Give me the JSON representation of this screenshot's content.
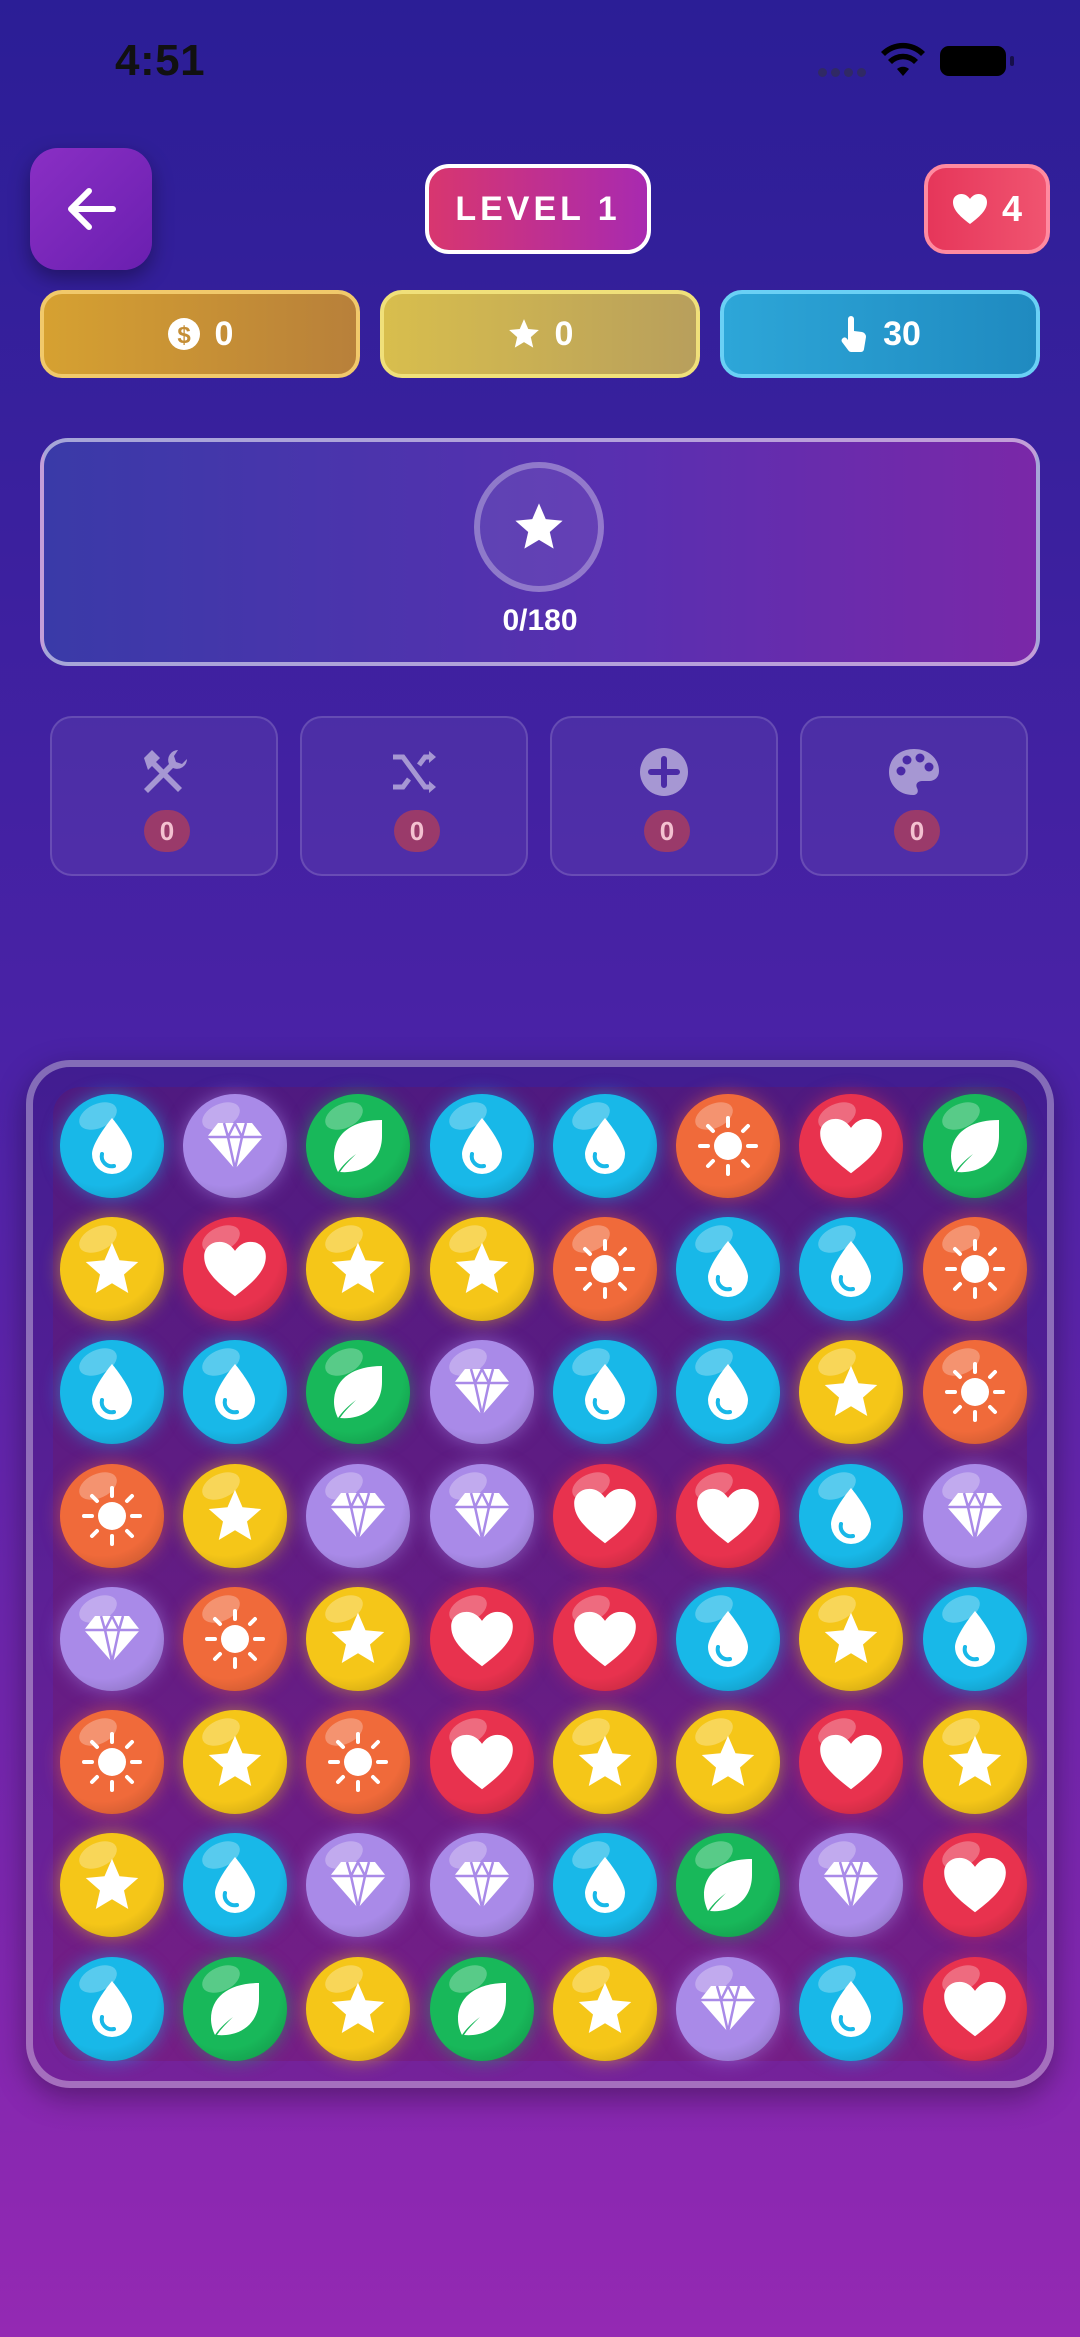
{
  "status_bar": {
    "time": "4:51"
  },
  "header": {
    "back_icon": "arrow-left-icon",
    "level_label": "LEVEL 1",
    "lives": "4"
  },
  "stats": {
    "coins": "0",
    "stars": "0",
    "moves": "30"
  },
  "goal": {
    "icon": "star-icon",
    "progress": "0/180"
  },
  "boosters": [
    {
      "name": "tools",
      "icon": "tools-icon",
      "count": "0"
    },
    {
      "name": "shuffle",
      "icon": "shuffle-icon",
      "count": "0"
    },
    {
      "name": "add",
      "icon": "plus-circle-icon",
      "count": "0"
    },
    {
      "name": "paint",
      "icon": "palette-icon",
      "count": "0"
    }
  ],
  "colors": {
    "drop": "#18b8e8",
    "diamond": "#a98ae8",
    "leaf": "#18b85a",
    "sun": "#f06a3a",
    "heart": "#e8324e",
    "star": "#f5c618"
  },
  "board": [
    [
      "drop",
      "diamond",
      "leaf",
      "drop",
      "drop",
      "sun",
      "heart",
      "leaf"
    ],
    [
      "star",
      "heart",
      "star",
      "star",
      "sun",
      "drop",
      "drop",
      "sun"
    ],
    [
      "drop",
      "drop",
      "leaf",
      "diamond",
      "drop",
      "drop",
      "star",
      "sun"
    ],
    [
      "sun",
      "star",
      "diamond",
      "diamond",
      "heart",
      "heart",
      "drop",
      "diamond"
    ],
    [
      "diamond",
      "sun",
      "star",
      "heart",
      "heart",
      "drop",
      "star",
      "drop"
    ],
    [
      "sun",
      "star",
      "sun",
      "heart",
      "star",
      "star",
      "heart",
      "star"
    ],
    [
      "star",
      "drop",
      "diamond",
      "diamond",
      "drop",
      "leaf",
      "diamond",
      "heart"
    ],
    [
      "drop",
      "leaf",
      "star",
      "leaf",
      "star",
      "diamond",
      "drop",
      "heart"
    ]
  ]
}
